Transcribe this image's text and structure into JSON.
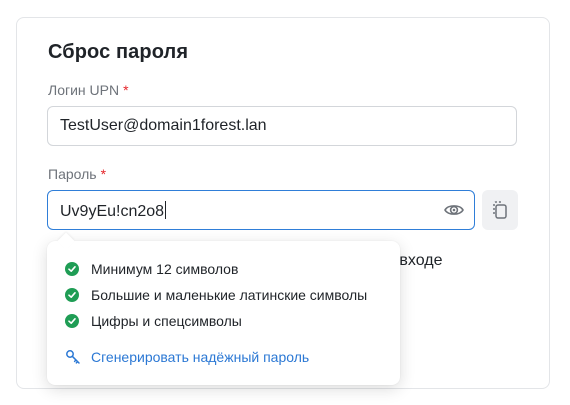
{
  "form": {
    "title": "Сброс пароля",
    "login": {
      "label": "Логин UPN",
      "required_mark": "*",
      "value": "TestUser@domain1forest.lan"
    },
    "password": {
      "label": "Пароль",
      "required_mark": "*",
      "value": "Uv9yEu!cn2o8",
      "toggle_icon": "eye-icon"
    },
    "copy_icon": "copy-icon",
    "partially_hidden_text": "и входе"
  },
  "password_hints": {
    "rules": [
      {
        "label": "Минимум 12 символов",
        "status": "ok"
      },
      {
        "label": "Большие и маленькие латинские символы",
        "status": "ok"
      },
      {
        "label": "Цифры и спецсимволы",
        "status": "ok"
      }
    ],
    "generate_label": "Сгенерировать надёжный пароль",
    "generate_icon": "key-icon"
  },
  "colors": {
    "accent": "#2f7ed8",
    "link": "#2b78d4",
    "success": "#1f9d55",
    "required": "#e5252a"
  }
}
